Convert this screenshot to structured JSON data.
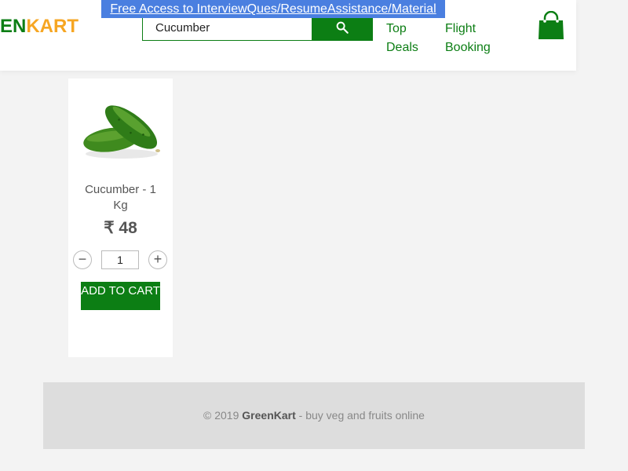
{
  "brand": {
    "green": "EN",
    "orange": "KART",
    "green_color": "#0c7e14",
    "orange_color": "#f6a623"
  },
  "promo": {
    "text": "Free Access to InterviewQues/ResumeAssistance/Material",
    "color": "#4a7fe0"
  },
  "search": {
    "value": "Cucumber",
    "button_icon": "search-icon"
  },
  "nav": {
    "top_deals": "Top Deals",
    "flight_booking": "Flight Booking"
  },
  "cart": {
    "icon": "shopping-bag-icon"
  },
  "product": {
    "name": "Cucumber - 1 Kg",
    "price": "₹ 48",
    "quantity": "1",
    "decrement": "−",
    "increment": "+",
    "add_label": "ADD TO CART"
  },
  "footer": {
    "copyright": "© 2019",
    "brand": "GreenKart",
    "tagline": "- buy veg and fruits online"
  },
  "accent": "#0c7e14"
}
